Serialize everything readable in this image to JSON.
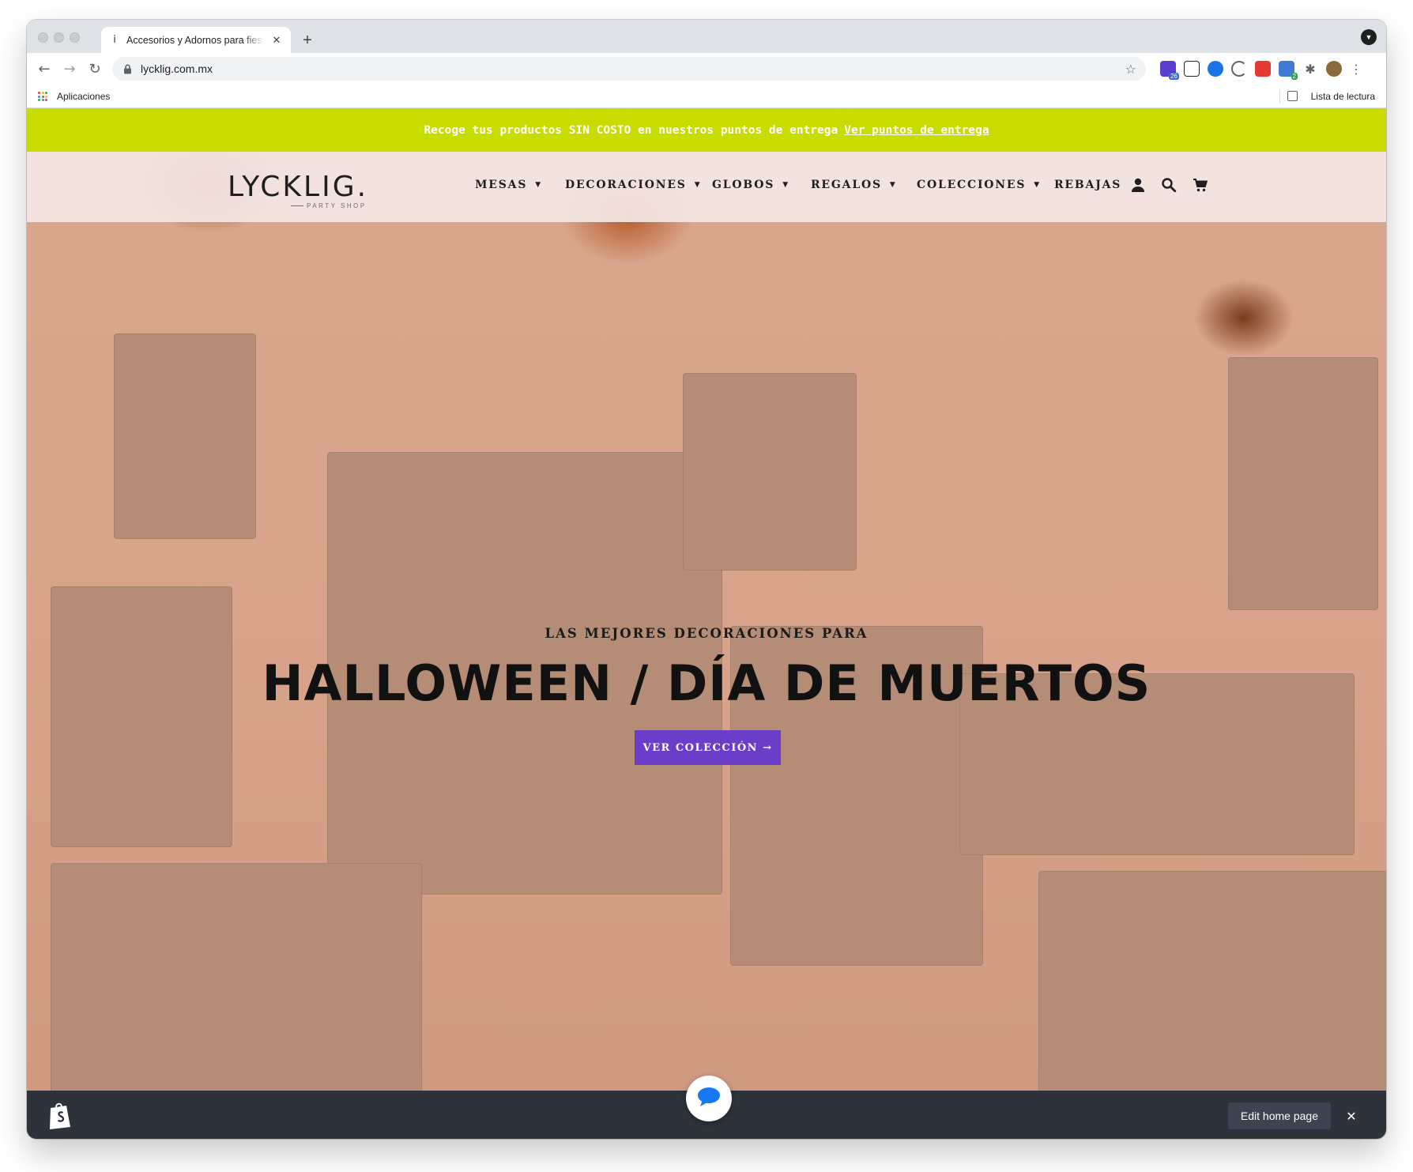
{
  "browser": {
    "tab_title": "Accesorios y Adornos para fiestas",
    "tab_favicon": "i",
    "url": "lycklig.com.mx",
    "bookmarks": {
      "apps_label": "Aplicaciones",
      "reading_list_label": "Lista de lectura"
    },
    "extension_badges": {
      "first": "26",
      "second": "2"
    }
  },
  "store": {
    "announcement": {
      "text": "Recoge tus productos SIN COSTO en nuestros puntos de entrega",
      "link_text": "Ver puntos de entrega"
    },
    "logo": {
      "wordmark": "LYCKLIG.",
      "tagline": "PARTY SHOP"
    },
    "nav": [
      {
        "label": "MESAS",
        "has_dropdown": true
      },
      {
        "label": "DECORACIONES",
        "has_dropdown": true
      },
      {
        "label": "GLOBOS",
        "has_dropdown": true
      },
      {
        "label": "REGALOS",
        "has_dropdown": true
      },
      {
        "label": "COLECCIONES",
        "has_dropdown": true
      },
      {
        "label": "REBAJAS",
        "has_dropdown": false
      }
    ],
    "header_icons": [
      "account-icon",
      "search-icon",
      "cart-icon"
    ],
    "hero": {
      "eyebrow": "LAS MEJORES DECORACIONES PARA",
      "headline": "HALLOWEEN / DÍA DE MUERTOS",
      "cta_label": "VER COLECCIÓN →"
    },
    "admin_bar": {
      "edit_label": "Edit home page",
      "close_glyph": "✕"
    }
  },
  "colors": {
    "announcement_bg": "#c8dc00",
    "cta_bg": "#6b3ec9",
    "admin_bar_bg": "#232c36"
  }
}
